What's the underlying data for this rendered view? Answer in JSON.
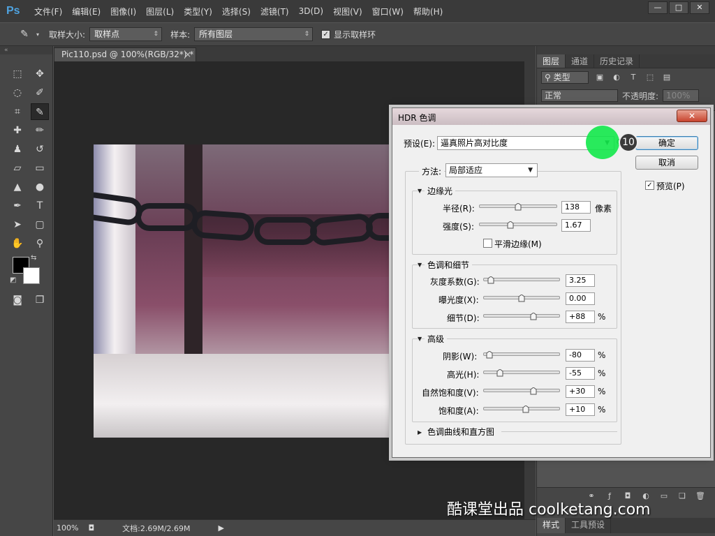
{
  "menubar": {
    "logo": "Ps",
    "items": [
      "文件(F)",
      "编辑(E)",
      "图像(I)",
      "图层(L)",
      "类型(Y)",
      "选择(S)",
      "滤镜(T)",
      "3D(D)",
      "视图(V)",
      "窗口(W)",
      "帮助(H)"
    ],
    "window_controls": [
      "—",
      "□",
      "✕"
    ]
  },
  "options": {
    "sample_size_label": "取样大小:",
    "sample_size_value": "取样点",
    "sample_label": "样本:",
    "sample_value": "所有图层",
    "show_ring_label": "显示取样环",
    "show_ring_checked": "✓"
  },
  "document": {
    "tab_title": "Pic110.psd @ 100%(RGB/32*) *",
    "tab_close": "×",
    "status_zoom": "100%",
    "status_doc": "文档:2.69M/2.69M"
  },
  "panel": {
    "tabs": [
      "图层",
      "通道",
      "历史记录"
    ],
    "filter_kind": "类型",
    "blend_mode": "正常",
    "opacity_label": "不透明度:",
    "opacity_value": "100%",
    "bottom_tabs": [
      "样式",
      "工具预设"
    ]
  },
  "dialog": {
    "title": "HDR 色调",
    "close": "✕",
    "preset_label": "预设(E):",
    "preset_value": "逼真照片高对比度",
    "ok_label": "确定",
    "cancel_label": "取消",
    "preview_label": "预览(P)",
    "preview_checked": "✓",
    "method_label": "方法:",
    "method_value": "局部适应",
    "edge_glow": {
      "title": "边缘光",
      "radius_label": "半径(R):",
      "radius_value": "138",
      "radius_unit": "像素",
      "radius_pos": 0.5,
      "strength_label": "强度(S):",
      "strength_value": "1.67",
      "strength_pos": 0.4,
      "smooth_label": "平滑边缘(M)"
    },
    "tone_detail": {
      "title": "色调和细节",
      "gamma_label": "灰度系数(G):",
      "gamma_value": "3.25",
      "gamma_pos": 0.1,
      "exposure_label": "曝光度(X):",
      "exposure_value": "0.00",
      "exposure_pos": 0.5,
      "detail_label": "细节(D):",
      "detail_value": "+88",
      "detail_unit": "%",
      "detail_pos": 0.65
    },
    "advanced": {
      "title": "高级",
      "shadow_label": "阴影(W):",
      "shadow_value": "-80",
      "shadow_pos": 0.08,
      "highlight_label": "高光(H):",
      "highlight_value": "-55",
      "highlight_pos": 0.22,
      "vibrance_label": "自然饱和度(V):",
      "vibrance_value": "+30",
      "vibrance_pos": 0.65,
      "saturation_label": "饱和度(A):",
      "saturation_value": "+10",
      "saturation_pos": 0.55,
      "unit": "%"
    },
    "curve_section": "色调曲线和直方图"
  },
  "overlay": {
    "step_number": "10",
    "watermark": "酷课堂出品 coolketang.com"
  }
}
